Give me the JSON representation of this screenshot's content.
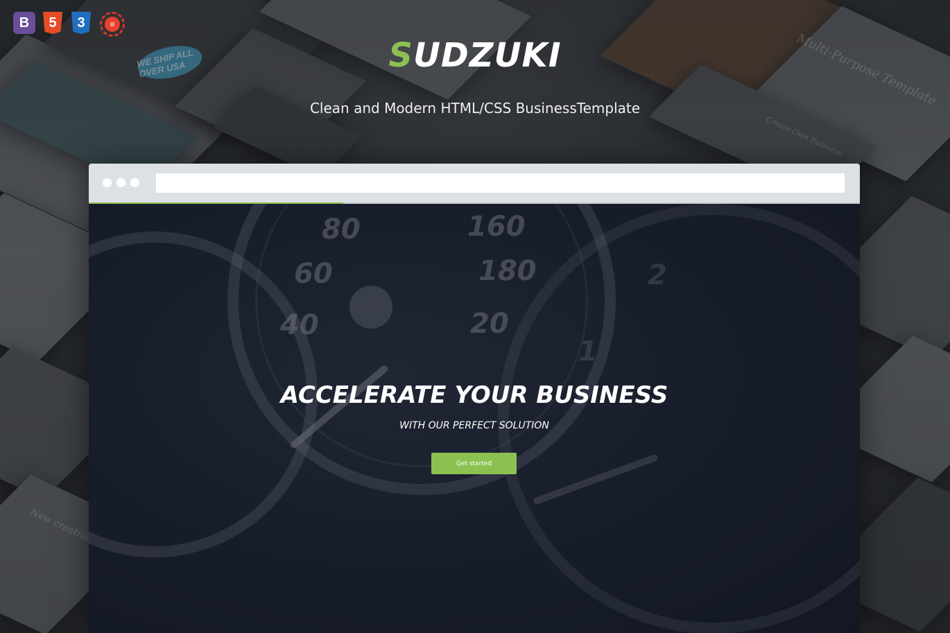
{
  "header": {
    "brand_accent": "S",
    "brand_rest": "UDZUKI",
    "tagline": "Clean and Modern HTML/CSS BusinessTemplate"
  },
  "badges": {
    "bootstrap": "B",
    "html5": "5",
    "css3": "3",
    "laurel": "≡"
  },
  "background": {
    "texts": [
      "Multi-Purpose Template",
      "Create Own Business",
      "New creative",
      "WE SHIP ALL OVER USA"
    ]
  },
  "browser": {
    "address_value": "",
    "progress_percent": 33
  },
  "hero": {
    "title": "ACCELERATE YOUR BUSINESS",
    "subtitle": "WITH OUR PERFECT SOLUTION",
    "cta_label": "Get started",
    "gauge_numbers": [
      "80",
      "60",
      "40",
      "160",
      "180",
      "20",
      "2",
      "1"
    ]
  },
  "colors": {
    "accent": "#8cc152",
    "hero_background": "#1d2332",
    "browser_bar": "#dde1e5"
  },
  "icons": [
    "bootstrap-icon",
    "html5-icon",
    "css3-icon",
    "laurel-badge-icon"
  ]
}
